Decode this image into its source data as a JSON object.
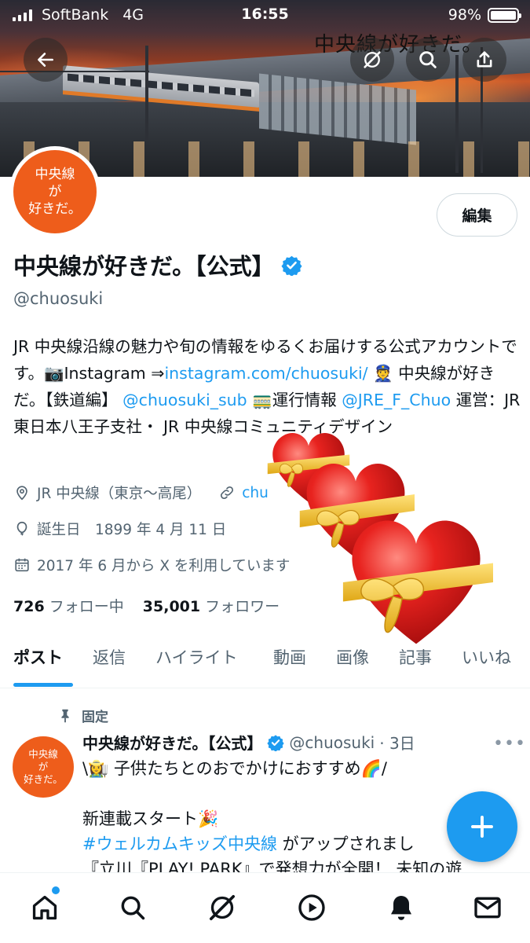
{
  "status_bar": {
    "carrier": "SoftBank",
    "network": "4G",
    "time": "16:55",
    "battery": "98%"
  },
  "banner": {
    "caption": "中央線が好きだ。"
  },
  "avatar": {
    "line1": "中央線",
    "line2": "が",
    "line3": "好きだ。"
  },
  "profile": {
    "edit_label": "編集",
    "name": "中央線が好きだ。【公式】",
    "handle": "@chuosuki",
    "bio": {
      "p1": "JR 中央線沿線の魅力や旬の情報をゆるくお届けする公式アカウントです。📷Instagram ⇒",
      "link_instagram": "instagram.com/chuosuki/",
      "p2": " 👮 中央線が好きだ。【鉄道編】",
      "link_sub": "@chuosuki_sub",
      "p3": " 🚃運行情報",
      "link_jre": "@JRE_F_Chuo",
      "p4": " 運営：JR 東日本八王子支社・ JR 中央線コミュニティデザイン"
    },
    "location": "JR 中央線（東京〜高尾）",
    "website": "chu",
    "birthday": "誕生日　1899 年 4 月 11 日",
    "joined": "2017 年 6 月から X を利用しています",
    "following_count": "726",
    "following_label": "フォロー中",
    "followers_count": "35,001",
    "followers_label": "フォロワー"
  },
  "tabs": [
    "ポスト",
    "返信",
    "ハイライト",
    "動画",
    "画像",
    "記事",
    "いいね"
  ],
  "post": {
    "pinned_label": "固定",
    "author": "中央線が好きだ。【公式】",
    "handle": "@chuosuki",
    "age": "· 3日",
    "line1": "\\👩‍🌾 子供たちとのおでかけにおすすめ🌈/",
    "line2": "新連載スタート🎉",
    "hashtag": "#ウェルカムキッズ中央線",
    "line3_rest": " がアップされまし",
    "line4": "『立川『PLAY! PARK』で発想力が全開！ 未知の遊"
  },
  "colors": {
    "accent": "#1d9bf0",
    "brand_orange": "#ee5d1b",
    "text": "#0f1419",
    "muted": "#536471"
  },
  "icons": [
    "back-arrow-icon",
    "grok-icon",
    "search-icon",
    "share-icon",
    "verified-badge-icon",
    "location-icon",
    "link-icon",
    "balloon-icon",
    "calendar-icon",
    "pin-icon",
    "more-icon",
    "compose-plus-icon",
    "home-icon",
    "explore-icon",
    "grok-nav-icon",
    "video-icon",
    "notifications-icon",
    "messages-icon",
    "heart-gift-sticker"
  ]
}
